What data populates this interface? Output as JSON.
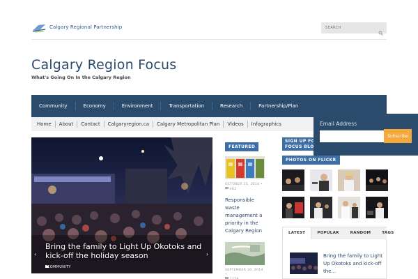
{
  "header": {
    "logo_text": "Calgary Regional Partnership",
    "search_placeholder": "SEARCH",
    "site_title": "Calgary Region Focus",
    "tagline": "What's Going On In the Calgary Region"
  },
  "main_nav": [
    "Community",
    "Economy",
    "Environment",
    "Transportation",
    "Research",
    "Partnership/Plan"
  ],
  "sub_nav": [
    "Home",
    "About",
    "Contact",
    "Calgaryregion.ca",
    "Calgary Metropolitan Plan",
    "Videos",
    "Infographics"
  ],
  "slider": {
    "caption": "Bring the family to Light Up Okotoks and kick-off the holiday season",
    "category": "COMMUNITY",
    "prev_arrow": "‹",
    "next_arrow": "›"
  },
  "featured": {
    "badge": "FEATURED",
    "posts": [
      {
        "date": "OCTOBER 15, 2014 •",
        "comments": "462",
        "title": "Responsible waste management a priority in the Calgary Region"
      },
      {
        "date": "SEPTEMBER 30, 2014 •",
        "comments": "1258",
        "title": ""
      }
    ]
  },
  "sidebar": {
    "signup_label": "SIGN UP FOR FOCUS BLOG",
    "flickr_label": "PHOTOS ON FLICKR",
    "tabs": [
      "LATEST",
      "POPULAR",
      "RANDOM",
      "TAGS"
    ],
    "latest_title": "Bring the family to Light Up Okotoks and kick-off the..."
  },
  "popup": {
    "email_label": "Email Address",
    "email_value": "",
    "subscribe_label": "Subscribe"
  },
  "colors": {
    "nav_blue": "#2b4b6d",
    "badge_blue": "#3d6ea6",
    "subscribe_orange": "#f5a83c"
  }
}
